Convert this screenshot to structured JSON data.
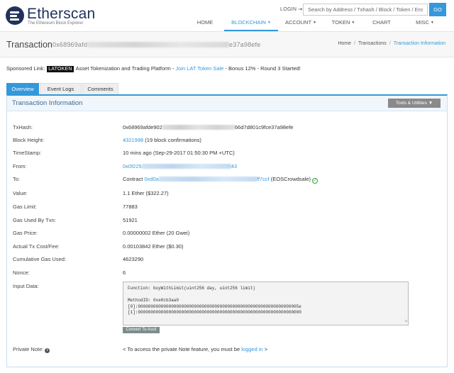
{
  "header": {
    "logo_name": "Etherscan",
    "logo_sub": "The Ethereum Block Explorer",
    "login_label": "LOGIN",
    "search_placeholder": "Search by Address / Txhash / Block / Token / Ens",
    "go_label": "GO",
    "nav": [
      {
        "label": "HOME",
        "has_caret": false
      },
      {
        "label": "BLOCKCHAIN",
        "has_caret": true
      },
      {
        "label": "ACCOUNT",
        "has_caret": true
      },
      {
        "label": "TOKEN",
        "has_caret": true
      },
      {
        "label": "CHART",
        "has_caret": false
      },
      {
        "label": "MISC",
        "has_caret": true
      }
    ]
  },
  "titlebar": {
    "title": "Transaction",
    "hash_start": "0x68969afd",
    "hash_end": "e37a98efe",
    "breadcrumb": [
      "Home",
      "Transactions",
      "Transaction Information"
    ]
  },
  "sponsored": {
    "label": "Sponsored Link:",
    "badge": "LATOKEN",
    "text": "Asset Tokenization and Trading Platform - ",
    "link": "Join LAT Token Sale",
    "suffix": " - Bonus 12% - Round 3 Started!"
  },
  "tabs": [
    "Overview",
    "Event Logs",
    "Comments"
  ],
  "panel": {
    "title": "Transaction Information",
    "tools_label": "Tools & Utilities"
  },
  "details": {
    "txhash_label": "TxHash:",
    "txhash_start": "0x68969afde902",
    "txhash_end": "66d7d801c9fce37a98efe",
    "block_label": "Block Height:",
    "block_value": "4321998",
    "block_conf": "(19 block confirmations)",
    "timestamp_label": "TimeStamp:",
    "timestamp_value": "10 mins ago (Sep-29-2017 01:50:30 PM +UTC)",
    "from_label": "From:",
    "from_start": "0x0f225",
    "from_end": "43",
    "to_label": "To:",
    "to_prefix": "Contract",
    "to_start": "0xd0a",
    "to_end": "ff7ccf",
    "to_name": "(EOSCrowdsale)",
    "value_label": "Value:",
    "value_value": "1.1 Ether ($322.27)",
    "gas_limit_label": "Gas Limit:",
    "gas_limit_value": "77883",
    "gas_used_label": "Gas Used By Txn:",
    "gas_used_value": "51921",
    "gas_price_label": "Gas Price:",
    "gas_price_value": "0.00000002 Ether (20 Gwei)",
    "cost_label": "Actual Tx Cost/Fee:",
    "cost_value": "0.00103842 Ether ($0.30)",
    "cumulative_label": "Cumulative Gas Used:",
    "cumulative_value": "4623290",
    "nonce_label": "Nonce:",
    "nonce_value": "6",
    "input_label": "Input Data:",
    "input_value": "Function: buyWithLimit(uint256 day, uint256 limit)\n\nMethodID: 0xe0cb3aa0\n[0]:000000000000000000000000000000000000000000000000000000000000005e\n[1]:0000000000000000000000000000000000000000000000000000000000000000",
    "ascii_label": "Convert To Ascii",
    "private_label": "Private Note:",
    "private_prefix": "< To access the private Note feature, you must be ",
    "private_link": "logged in",
    "private_suffix": " >"
  },
  "colors": {
    "accent": "#3498db",
    "brand": "#21325b",
    "success": "#2e9e3a"
  }
}
